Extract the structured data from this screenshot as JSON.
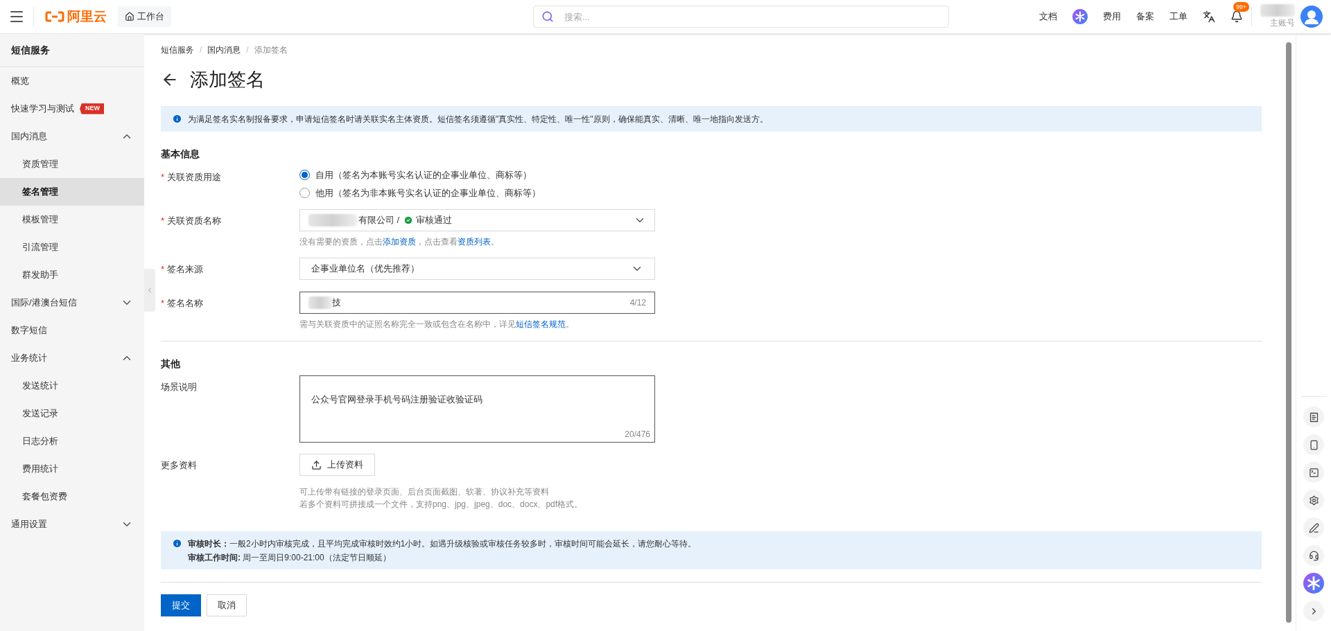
{
  "topbar": {
    "logo": "阿里云",
    "workbench": "工作台",
    "search": {
      "placeholder": "搜索..."
    },
    "links": [
      {
        "kind": "text",
        "label": "文档"
      },
      {
        "kind": "ai"
      },
      {
        "kind": "text",
        "label": "费用"
      },
      {
        "kind": "text",
        "label": "备案"
      },
      {
        "kind": "text",
        "label": "工单"
      },
      {
        "kind": "lang"
      },
      {
        "kind": "bell",
        "badge": "99+"
      }
    ],
    "account": "主账号"
  },
  "sidebar": {
    "title": "短信服务",
    "items": [
      {
        "label": "概览",
        "selected": false
      },
      {
        "label": "快速学习与测试",
        "badge": "NEW",
        "selected": false
      },
      {
        "label": "国内消息",
        "expanded": true,
        "children": [
          {
            "label": "资质管理",
            "selected": false
          },
          {
            "label": "签名管理",
            "selected": true
          },
          {
            "label": "模板管理",
            "selected": false
          },
          {
            "label": "引流管理",
            "selected": false
          },
          {
            "label": "群发助手",
            "selected": false
          }
        ]
      },
      {
        "label": "国际/港澳台短信",
        "expanded": false
      },
      {
        "label": "数字短信",
        "selected": false
      },
      {
        "label": "业务统计",
        "expanded": true,
        "children": [
          {
            "label": "发送统计",
            "selected": false
          },
          {
            "label": "发送记录",
            "selected": false
          },
          {
            "label": "日志分析",
            "selected": false
          },
          {
            "label": "费用统计",
            "selected": false
          },
          {
            "label": "套餐包资费",
            "selected": false
          }
        ]
      },
      {
        "label": "通用设置",
        "expanded": false
      }
    ]
  },
  "breadcrumb": [
    "短信服务",
    "国内消息",
    "添加签名"
  ],
  "breadcrumb_separator": "/",
  "required_mark": "*",
  "title": "添加签名",
  "notice": "为满足签名实名制报备要求，申请短信签名时请关联实名主体资质。短信签名须遵循\"真实性、特定性、唯一性\"原则，确保能真实、清晰、唯一地指向发送方。",
  "basic": {
    "heading": "基本信息",
    "usage": {
      "label": "关联资质用途",
      "options": [
        {
          "label": "自用（签名为本账号实名认证的企事业单位、商标等）",
          "selected": true
        },
        {
          "label": "他用（签名为非本账号实名认证的企事业单位、商标等）",
          "selected": false
        }
      ]
    },
    "qualification": {
      "label": "关联资质名称",
      "value": "有限公司 /",
      "status": "审核通过",
      "hint": [
        {
          "text": "没有需要的资质，点击"
        },
        {
          "link": "添加资质"
        },
        {
          "text": "，点击查看"
        },
        {
          "link": "资质列表"
        },
        {
          "text": "。"
        }
      ]
    },
    "source": {
      "label": "签名来源",
      "value": "企事业单位名（优先推荐）"
    },
    "name": {
      "label": "签名名称",
      "value": "技",
      "count": "4/12",
      "hint": [
        {
          "text": "需与关联资质中的证照名称完全一致或包含在名称中，详见"
        },
        {
          "link": "短信签名规范"
        },
        {
          "text": "。"
        }
      ]
    }
  },
  "other": {
    "heading": "其他",
    "scene": {
      "label": "场景说明",
      "value": "公众号官网登录手机号码注册验证收验证码",
      "count": "20/476"
    },
    "more": {
      "label": "更多资料",
      "button": "上传资料",
      "hints": [
        "可上传带有链接的登录页面、后台页面截图、软著、协议补充等资料",
        "若多个资料可拼接成一个文件，支持png、jpg、jpeg、doc、docx、pdf格式。"
      ]
    }
  },
  "review": {
    "lines": [
      "**审核时长：**一般2小时内审核完成，且平均完成审核时效约1小时。如遇升级核验或审核任务较多时，审核时间可能会延长，请您耐心等待。",
      "**审核工作时间:** 周一至周日9:00-21:00（法定节日顺延）"
    ]
  },
  "actions": {
    "submit": "提交",
    "cancel": "取消"
  }
}
